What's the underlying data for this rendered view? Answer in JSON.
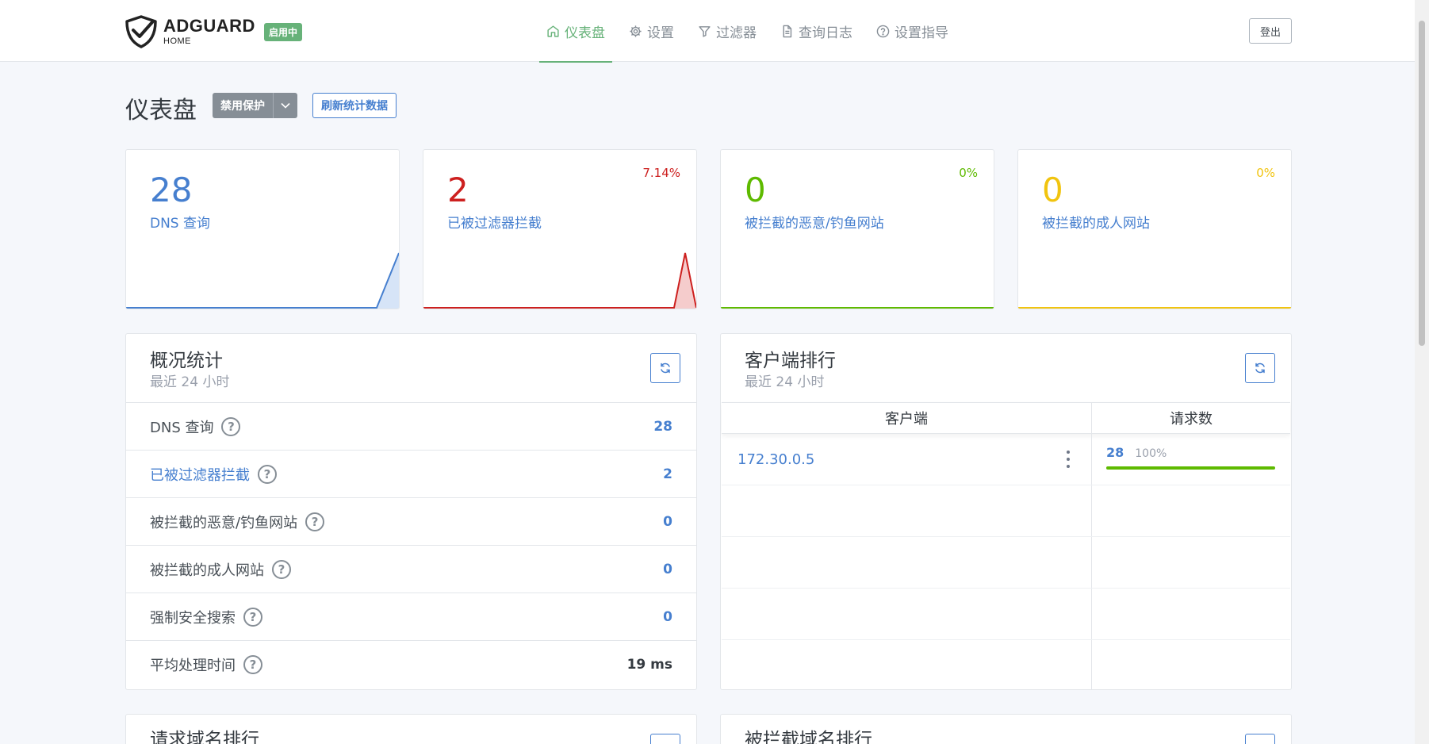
{
  "header": {
    "logo_main": "ADGUARD",
    "logo_sub": "HOME",
    "status_badge": "启用中",
    "nav": [
      {
        "label": "仪表盘",
        "icon": "home-icon",
        "active": true
      },
      {
        "label": "设置",
        "icon": "gear-icon"
      },
      {
        "label": "过滤器",
        "icon": "filter-icon"
      },
      {
        "label": "查询日志",
        "icon": "document-icon"
      },
      {
        "label": "设置指导",
        "icon": "help-circle-icon"
      }
    ],
    "logout_label": "登出"
  },
  "toolbar": {
    "page_title": "仪表盘",
    "disable_label": "禁用保护",
    "refresh_label": "刷新统计数据"
  },
  "stat_cards": [
    {
      "value": "28",
      "label": "DNS 查询",
      "percent": "",
      "color": "#467fcf"
    },
    {
      "value": "2",
      "label": "已被过滤器拦截",
      "percent": "7.14%",
      "color": "#cd201f",
      "label_color": "#467fcf"
    },
    {
      "value": "0",
      "label": "被拦截的恶意/钓鱼网站",
      "percent": "0%",
      "color": "#5eba00",
      "label_color": "#467fcf"
    },
    {
      "value": "0",
      "label": "被拦截的成人网站",
      "percent": "0%",
      "color": "#f1c40f",
      "label_color": "#467fcf"
    }
  ],
  "overview": {
    "title": "概况统计",
    "subtitle": "最近 24 小时",
    "rows": [
      {
        "label": "DNS 查询",
        "value": "28"
      },
      {
        "label": "已被过滤器拦截",
        "value": "2"
      },
      {
        "label": "被拦截的恶意/钓鱼网站",
        "value": "0"
      },
      {
        "label": "被拦截的成人网站",
        "value": "0"
      },
      {
        "label": "强制安全搜索",
        "value": "0"
      },
      {
        "label": "平均处理时间",
        "value": "19 ms"
      }
    ]
  },
  "clients": {
    "title": "客户端排行",
    "subtitle": "最近 24 小时",
    "col_client": "客户端",
    "col_count": "请求数",
    "rows": [
      {
        "client": "172.30.0.5",
        "count": "28",
        "percent": "100%",
        "fraction": 1.0
      }
    ]
  },
  "bottom_panels": {
    "left_title": "请求域名排行",
    "right_title": "被拦截域名排行"
  },
  "colors": {
    "accent": "#67b279",
    "link": "#467fcf",
    "danger": "#cd201f",
    "success": "#5eba00",
    "warning": "#f1c40f"
  }
}
